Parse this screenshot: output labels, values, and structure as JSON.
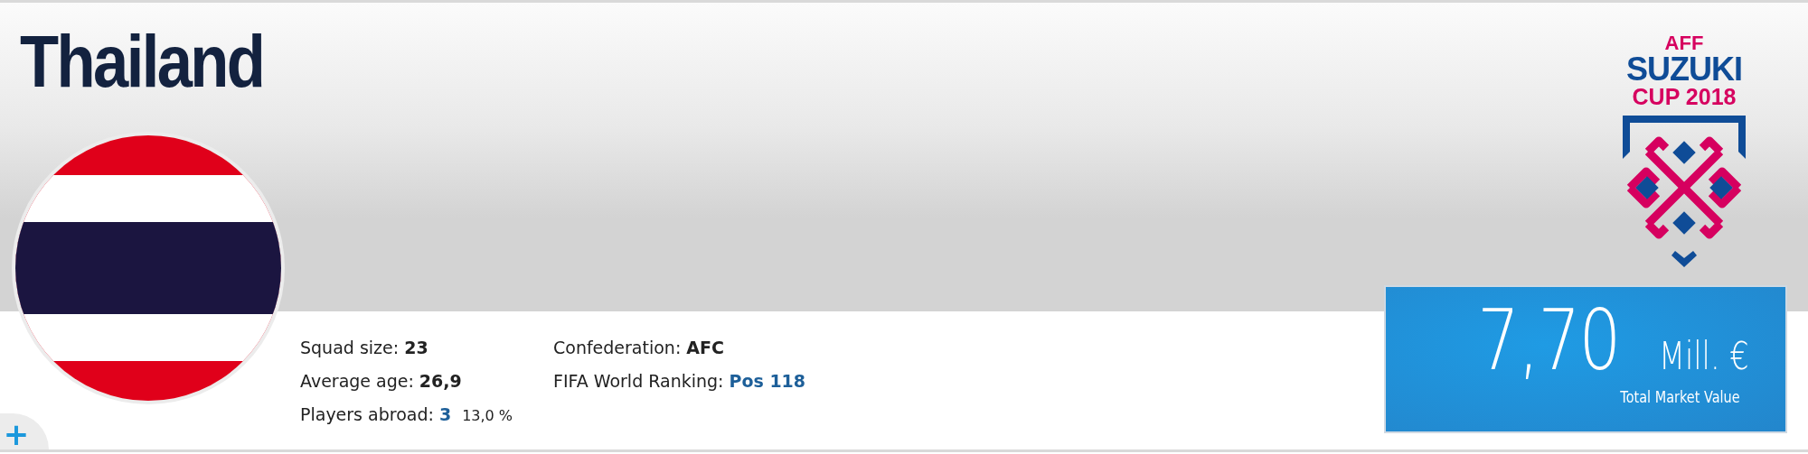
{
  "team": {
    "name": "Thailand"
  },
  "stats_left": [
    {
      "label": "Squad size:",
      "value": "23",
      "kind": "bold"
    },
    {
      "label": "Average age:",
      "value": "26,9",
      "kind": "bold"
    },
    {
      "label": "Players abroad:",
      "value": "3",
      "kind": "link",
      "extra": "13,0 %"
    }
  ],
  "stats_right": [
    {
      "label": "Confederation:",
      "value": "AFC",
      "kind": "bold"
    },
    {
      "label": "FIFA World Ranking:",
      "value": "Pos 118",
      "kind": "link"
    }
  ],
  "logo": {
    "lines": [
      {
        "text": "AFF",
        "color": "#d6005f"
      },
      {
        "text": "SUZUKI",
        "color": "#0f4c97"
      },
      {
        "text": "CUP 2018",
        "color": "#d6005f"
      }
    ]
  },
  "market_value": {
    "amount": "7,70",
    "unit": "Mill. €",
    "caption": "Total Market Value"
  },
  "expand_button": {
    "label": "+"
  }
}
